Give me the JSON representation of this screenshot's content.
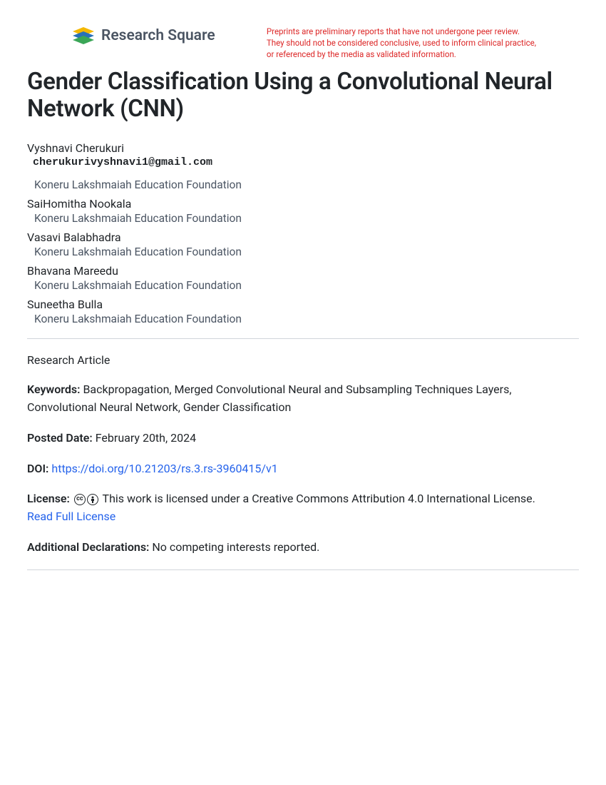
{
  "header": {
    "logo_text": "Research Square",
    "notice_line1": "Preprints are preliminary reports that have not undergone peer review.",
    "notice_line2": "They should not be considered conclusive, used to inform clinical practice,",
    "notice_line3": "or referenced by the media as validated information."
  },
  "title": "Gender Classification Using a Convolutional Neural Network (CNN)",
  "authors": [
    {
      "name": "Vyshnavi Cherukuri",
      "email": "cherukurivyshnavi1@gmail.com",
      "affiliation": "Koneru Lakshmaiah Education Foundation"
    },
    {
      "name": "SaiHomitha Nookala",
      "affiliation": "Koneru Lakshmaiah Education Foundation"
    },
    {
      "name": "Vasavi Balabhadra",
      "affiliation": "Koneru Lakshmaiah Education Foundation"
    },
    {
      "name": "Bhavana Mareedu",
      "affiliation": "Koneru Lakshmaiah Education Foundation"
    },
    {
      "name": "Suneetha Bulla",
      "affiliation": "Koneru Lakshmaiah Education Foundation"
    }
  ],
  "article_type": "Research Article",
  "keywords_label": "Keywords:",
  "keywords_text": "Backpropagation, Merged Convolutional Neural and Subsampling Techniques Layers, Convolutional Neural Network, Gender Classification",
  "posted_label": "Posted Date:",
  "posted_value": "February 20th, 2024",
  "doi_label": "DOI:",
  "doi_link": "https://doi.org/10.21203/rs.3.rs-3960415/v1",
  "license_label": "License:",
  "license_text": "This work is licensed under a Creative Commons Attribution 4.0 International License.",
  "license_link_text": "Read Full License",
  "declarations_label": "Additional Declarations:",
  "declarations_text": "No competing interests reported.",
  "cc_symbol": "cc",
  "by_symbol": "🄯"
}
